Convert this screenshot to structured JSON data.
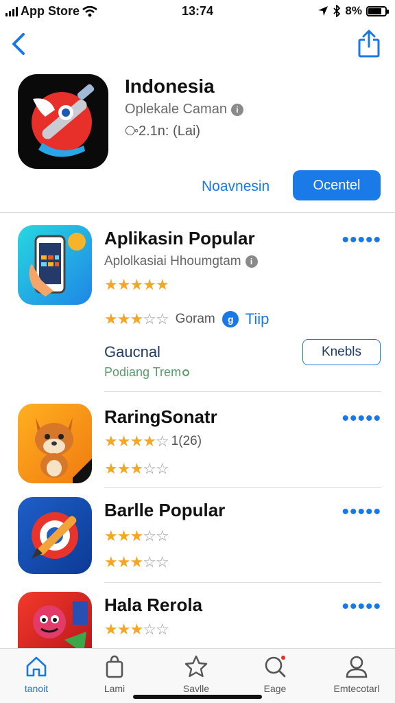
{
  "status": {
    "carrier": "App Store",
    "time": "13:74",
    "battery": "8%",
    "battery_level": 0.8
  },
  "hero": {
    "title": "Indonesia",
    "subtitle": "Oplekale Caman",
    "meta": "⧂2.1n: (Lai)",
    "link_label": "Noavnesin",
    "button_label": "Ocentel"
  },
  "apps": [
    {
      "name": "Aplikasin Popular",
      "subtitle": "Aplolkasiai Hhoumgtam",
      "rating_1": 5,
      "rating_2": 3,
      "rating_2_label": "Goram",
      "tip_label": "Tiip",
      "extra_title": "Gaucnal",
      "extra_sub": "Podiang Trem",
      "action_label": "Knebls"
    },
    {
      "name": "RaringSonatr",
      "rating_1": 4,
      "rating_1_label": "1(26)",
      "rating_2": 3
    },
    {
      "name": "Barlle Popular",
      "rating_1": 3,
      "rating_2": 3
    },
    {
      "name": "Hala Rerola",
      "rating_1": 3
    }
  ],
  "tabs": [
    {
      "label": "tanoit"
    },
    {
      "label": "Lami"
    },
    {
      "label": "Savlle"
    },
    {
      "label": "Eage"
    },
    {
      "label": "Emtecotarl"
    }
  ],
  "colors": {
    "accent": "#1a78e6",
    "star": "#f5a623"
  }
}
